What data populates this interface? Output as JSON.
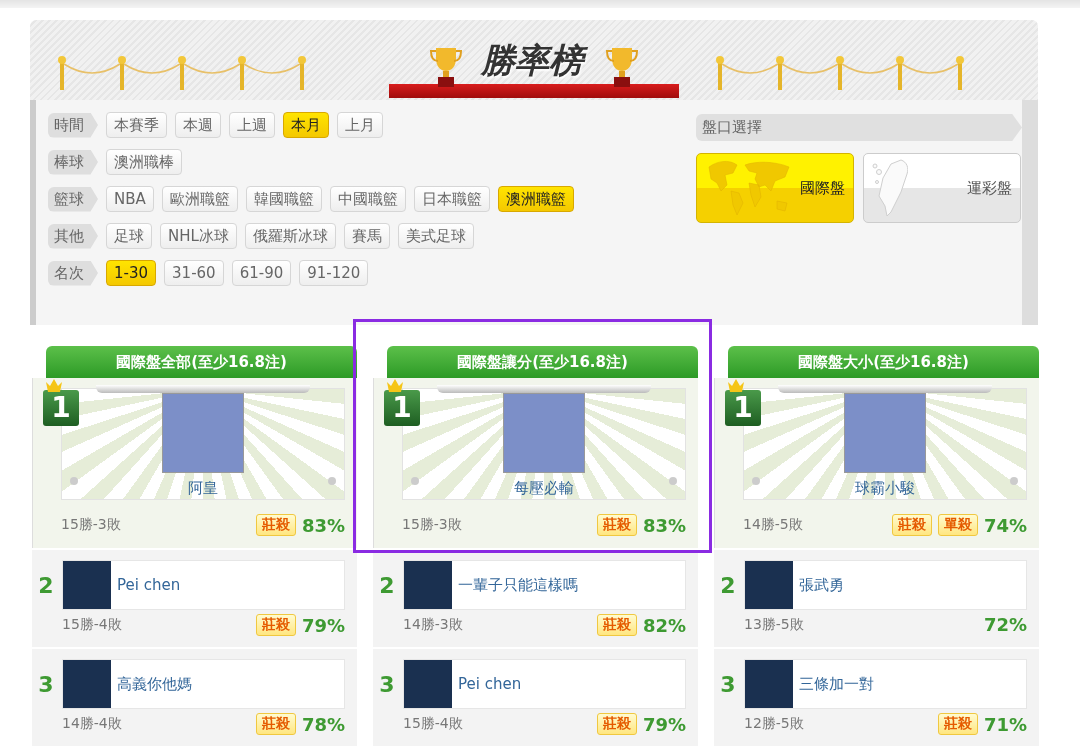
{
  "banner": {
    "title": "勝率榜"
  },
  "filters": [
    {
      "label": "時間",
      "options": [
        {
          "text": "本賽季",
          "selected": false
        },
        {
          "text": "本週",
          "selected": false
        },
        {
          "text": "上週",
          "selected": false
        },
        {
          "text": "本月",
          "selected": true
        },
        {
          "text": "上月",
          "selected": false
        }
      ]
    },
    {
      "label": "棒球",
      "options": [
        {
          "text": "澳洲職棒",
          "selected": false
        }
      ]
    },
    {
      "label": "籃球",
      "options": [
        {
          "text": "NBA",
          "selected": false
        },
        {
          "text": "歐洲職籃",
          "selected": false
        },
        {
          "text": "韓國職籃",
          "selected": false
        },
        {
          "text": "中國職籃",
          "selected": false
        },
        {
          "text": "日本職籃",
          "selected": false
        },
        {
          "text": "澳洲職籃",
          "selected": true
        }
      ]
    },
    {
      "label": "其他",
      "options": [
        {
          "text": "足球",
          "selected": false
        },
        {
          "text": "NHL冰球",
          "selected": false
        },
        {
          "text": "俄羅斯冰球",
          "selected": false
        },
        {
          "text": "賽馬",
          "selected": false
        },
        {
          "text": "美式足球",
          "selected": false
        }
      ]
    },
    {
      "label": "名次",
      "options": [
        {
          "text": "1-30",
          "selected": true
        },
        {
          "text": "31-60",
          "selected": false
        },
        {
          "text": "61-90",
          "selected": false
        },
        {
          "text": "91-120",
          "selected": false
        }
      ]
    }
  ],
  "market": {
    "label": "盤口選擇",
    "options": [
      {
        "text": "國際盤",
        "selected": true,
        "kind": "world"
      },
      {
        "text": "運彩盤",
        "selected": false,
        "kind": "taiwan"
      }
    ]
  },
  "columns": [
    {
      "title": "國際盤全部(至少16.8注)",
      "highlighted": false,
      "entries": [
        {
          "rank": "1",
          "name": "阿皇",
          "record": "15勝-3敗",
          "badges": [
            "莊殺"
          ],
          "rate": "83%"
        },
        {
          "rank": "2",
          "name": "Pei chen",
          "record": "15勝-4敗",
          "badges": [
            "莊殺"
          ],
          "rate": "79%"
        },
        {
          "rank": "3",
          "name": "高義你他媽",
          "record": "14勝-4敗",
          "badges": [
            "莊殺"
          ],
          "rate": "78%"
        }
      ]
    },
    {
      "title": "國際盤讓分(至少16.8注)",
      "highlighted": true,
      "entries": [
        {
          "rank": "1",
          "name": "每壓必輸",
          "record": "15勝-3敗",
          "badges": [
            "莊殺"
          ],
          "rate": "83%"
        },
        {
          "rank": "2",
          "name": "一輩子只能這樣嗎",
          "record": "14勝-3敗",
          "badges": [
            "莊殺"
          ],
          "rate": "82%"
        },
        {
          "rank": "3",
          "name": "Pei chen",
          "record": "15勝-4敗",
          "badges": [
            "莊殺"
          ],
          "rate": "79%"
        }
      ]
    },
    {
      "title": "國際盤大小(至少16.8注)",
      "highlighted": false,
      "entries": [
        {
          "rank": "1",
          "name": "球霸小駿",
          "record": "14勝-5敗",
          "badges": [
            "莊殺",
            "單殺"
          ],
          "rate": "74%"
        },
        {
          "rank": "2",
          "name": "張武勇",
          "record": "13勝-5敗",
          "rate": "72%"
        },
        {
          "rank": "3",
          "name": "三條加一對",
          "record": "12勝-5敗",
          "badges": [
            "莊殺"
          ],
          "rate": "71%"
        }
      ]
    }
  ]
}
